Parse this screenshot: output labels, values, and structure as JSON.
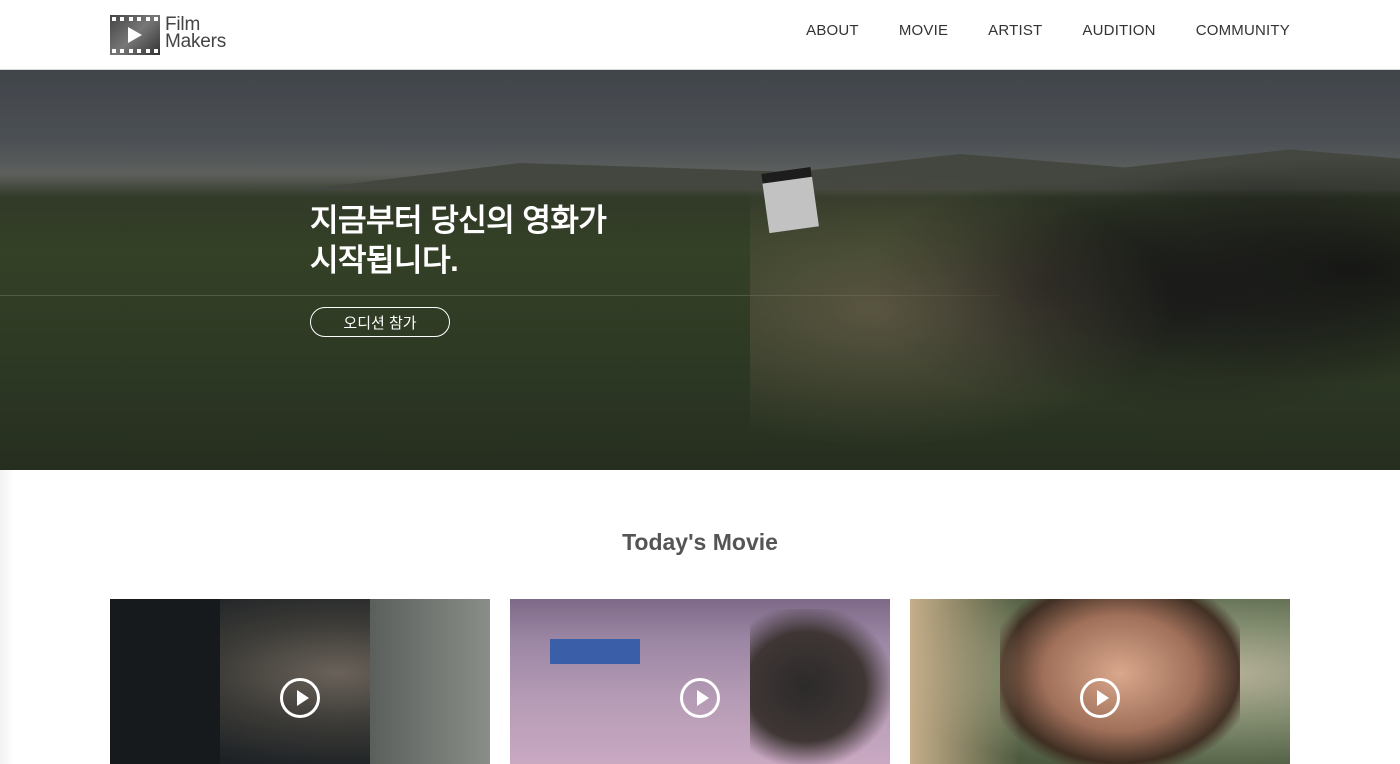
{
  "header": {
    "logo": {
      "line1": "Film",
      "line2": "Makers"
    },
    "nav": [
      {
        "label": "ABOUT"
      },
      {
        "label": "MOVIE"
      },
      {
        "label": "ARTIST"
      },
      {
        "label": "AUDITION"
      },
      {
        "label": "COMMUNITY"
      }
    ]
  },
  "hero": {
    "title_line1": "지금부터 당신의 영화가",
    "title_line2": "시작됩니다.",
    "button_label": "오디션 참가"
  },
  "todays_movie": {
    "title": "Today's Movie",
    "cards": [
      {
        "icon": "play-circle-icon"
      },
      {
        "icon": "play-circle-icon"
      },
      {
        "icon": "play-circle-icon"
      }
    ]
  },
  "colors": {
    "background": "#ffffff",
    "text": "#333333",
    "hero_text": "#ffffff"
  }
}
